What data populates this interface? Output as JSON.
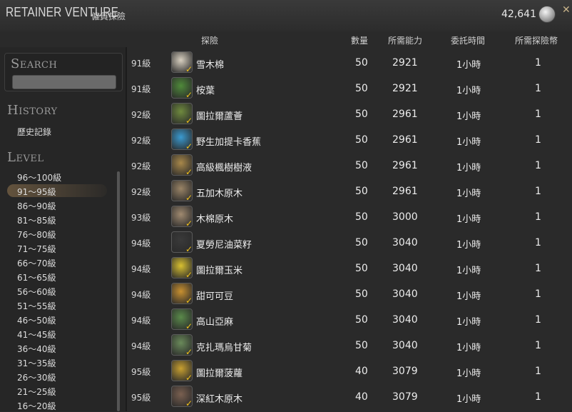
{
  "window": {
    "title": "RETAINER VENTURE",
    "subtitle": "僱員探險",
    "gil": "42,641",
    "gil_icon": "gil-coin-icon",
    "settings_icon": "wrench-icon"
  },
  "columns": {
    "venture": "探險",
    "quantity": "數量",
    "required": "所需能力",
    "duration": "委託時間",
    "tokens": "所需探險幣"
  },
  "sidebar": {
    "search_label": "Search",
    "search_value": "",
    "history_label": "History",
    "history_item": "歷史記錄",
    "level_label": "Level",
    "levels": [
      "96～100級",
      "91～95級",
      "86～90級",
      "81～85級",
      "76～80級",
      "71～75級",
      "66～70級",
      "61～65級",
      "56～60級",
      "51～55級",
      "46～50級",
      "41～45級",
      "36～40級",
      "31～35級",
      "26～30級",
      "21～25級",
      "16～20級"
    ],
    "selected_level": "91～95級"
  },
  "ventures": [
    {
      "level": "91級",
      "name": "雪木棉",
      "qty": "50",
      "req": "2921",
      "duration": "1小時",
      "tokens": "1",
      "icon_color": "#d8d0c0"
    },
    {
      "level": "91級",
      "name": "桉葉",
      "qty": "50",
      "req": "2921",
      "duration": "1小時",
      "tokens": "1",
      "icon_color": "#4f8a3a"
    },
    {
      "level": "92級",
      "name": "圖拉爾蘆薈",
      "qty": "50",
      "req": "2961",
      "duration": "1小時",
      "tokens": "1",
      "icon_color": "#6f8a3e"
    },
    {
      "level": "92級",
      "name": "野生加提卡香蕉",
      "qty": "50",
      "req": "2961",
      "duration": "1小時",
      "tokens": "1",
      "icon_color": "#3a9ad0"
    },
    {
      "level": "92級",
      "name": "高級楓樹樹液",
      "qty": "50",
      "req": "2961",
      "duration": "1小時",
      "tokens": "1",
      "icon_color": "#a8884a"
    },
    {
      "level": "92級",
      "name": "五加木原木",
      "qty": "50",
      "req": "2961",
      "duration": "1小時",
      "tokens": "1",
      "icon_color": "#9a8466"
    },
    {
      "level": "93級",
      "name": "木棉原木",
      "qty": "50",
      "req": "3000",
      "duration": "1小時",
      "tokens": "1",
      "icon_color": "#a08a70"
    },
    {
      "level": "94級",
      "name": "夏勞尼油菜籽",
      "qty": "50",
      "req": "3040",
      "duration": "1小時",
      "tokens": "1",
      "icon_color": "#3a3a3a"
    },
    {
      "level": "94級",
      "name": "圖拉爾玉米",
      "qty": "50",
      "req": "3040",
      "duration": "1小時",
      "tokens": "1",
      "icon_color": "#d8c030"
    },
    {
      "level": "94級",
      "name": "甜可可豆",
      "qty": "50",
      "req": "3040",
      "duration": "1小時",
      "tokens": "1",
      "icon_color": "#c89030"
    },
    {
      "level": "94級",
      "name": "高山亞麻",
      "qty": "50",
      "req": "3040",
      "duration": "1小時",
      "tokens": "1",
      "icon_color": "#5a8a4a"
    },
    {
      "level": "94級",
      "name": "克扎瑪烏甘菊",
      "qty": "50",
      "req": "3040",
      "duration": "1小時",
      "tokens": "1",
      "icon_color": "#6a8a5a"
    },
    {
      "level": "95級",
      "name": "圖拉爾菠蘿",
      "qty": "40",
      "req": "3079",
      "duration": "1小時",
      "tokens": "1",
      "icon_color": "#c8a030"
    },
    {
      "level": "95級",
      "name": "深紅木原木",
      "qty": "40",
      "req": "3079",
      "duration": "1小時",
      "tokens": "1",
      "icon_color": "#7a6050"
    }
  ]
}
